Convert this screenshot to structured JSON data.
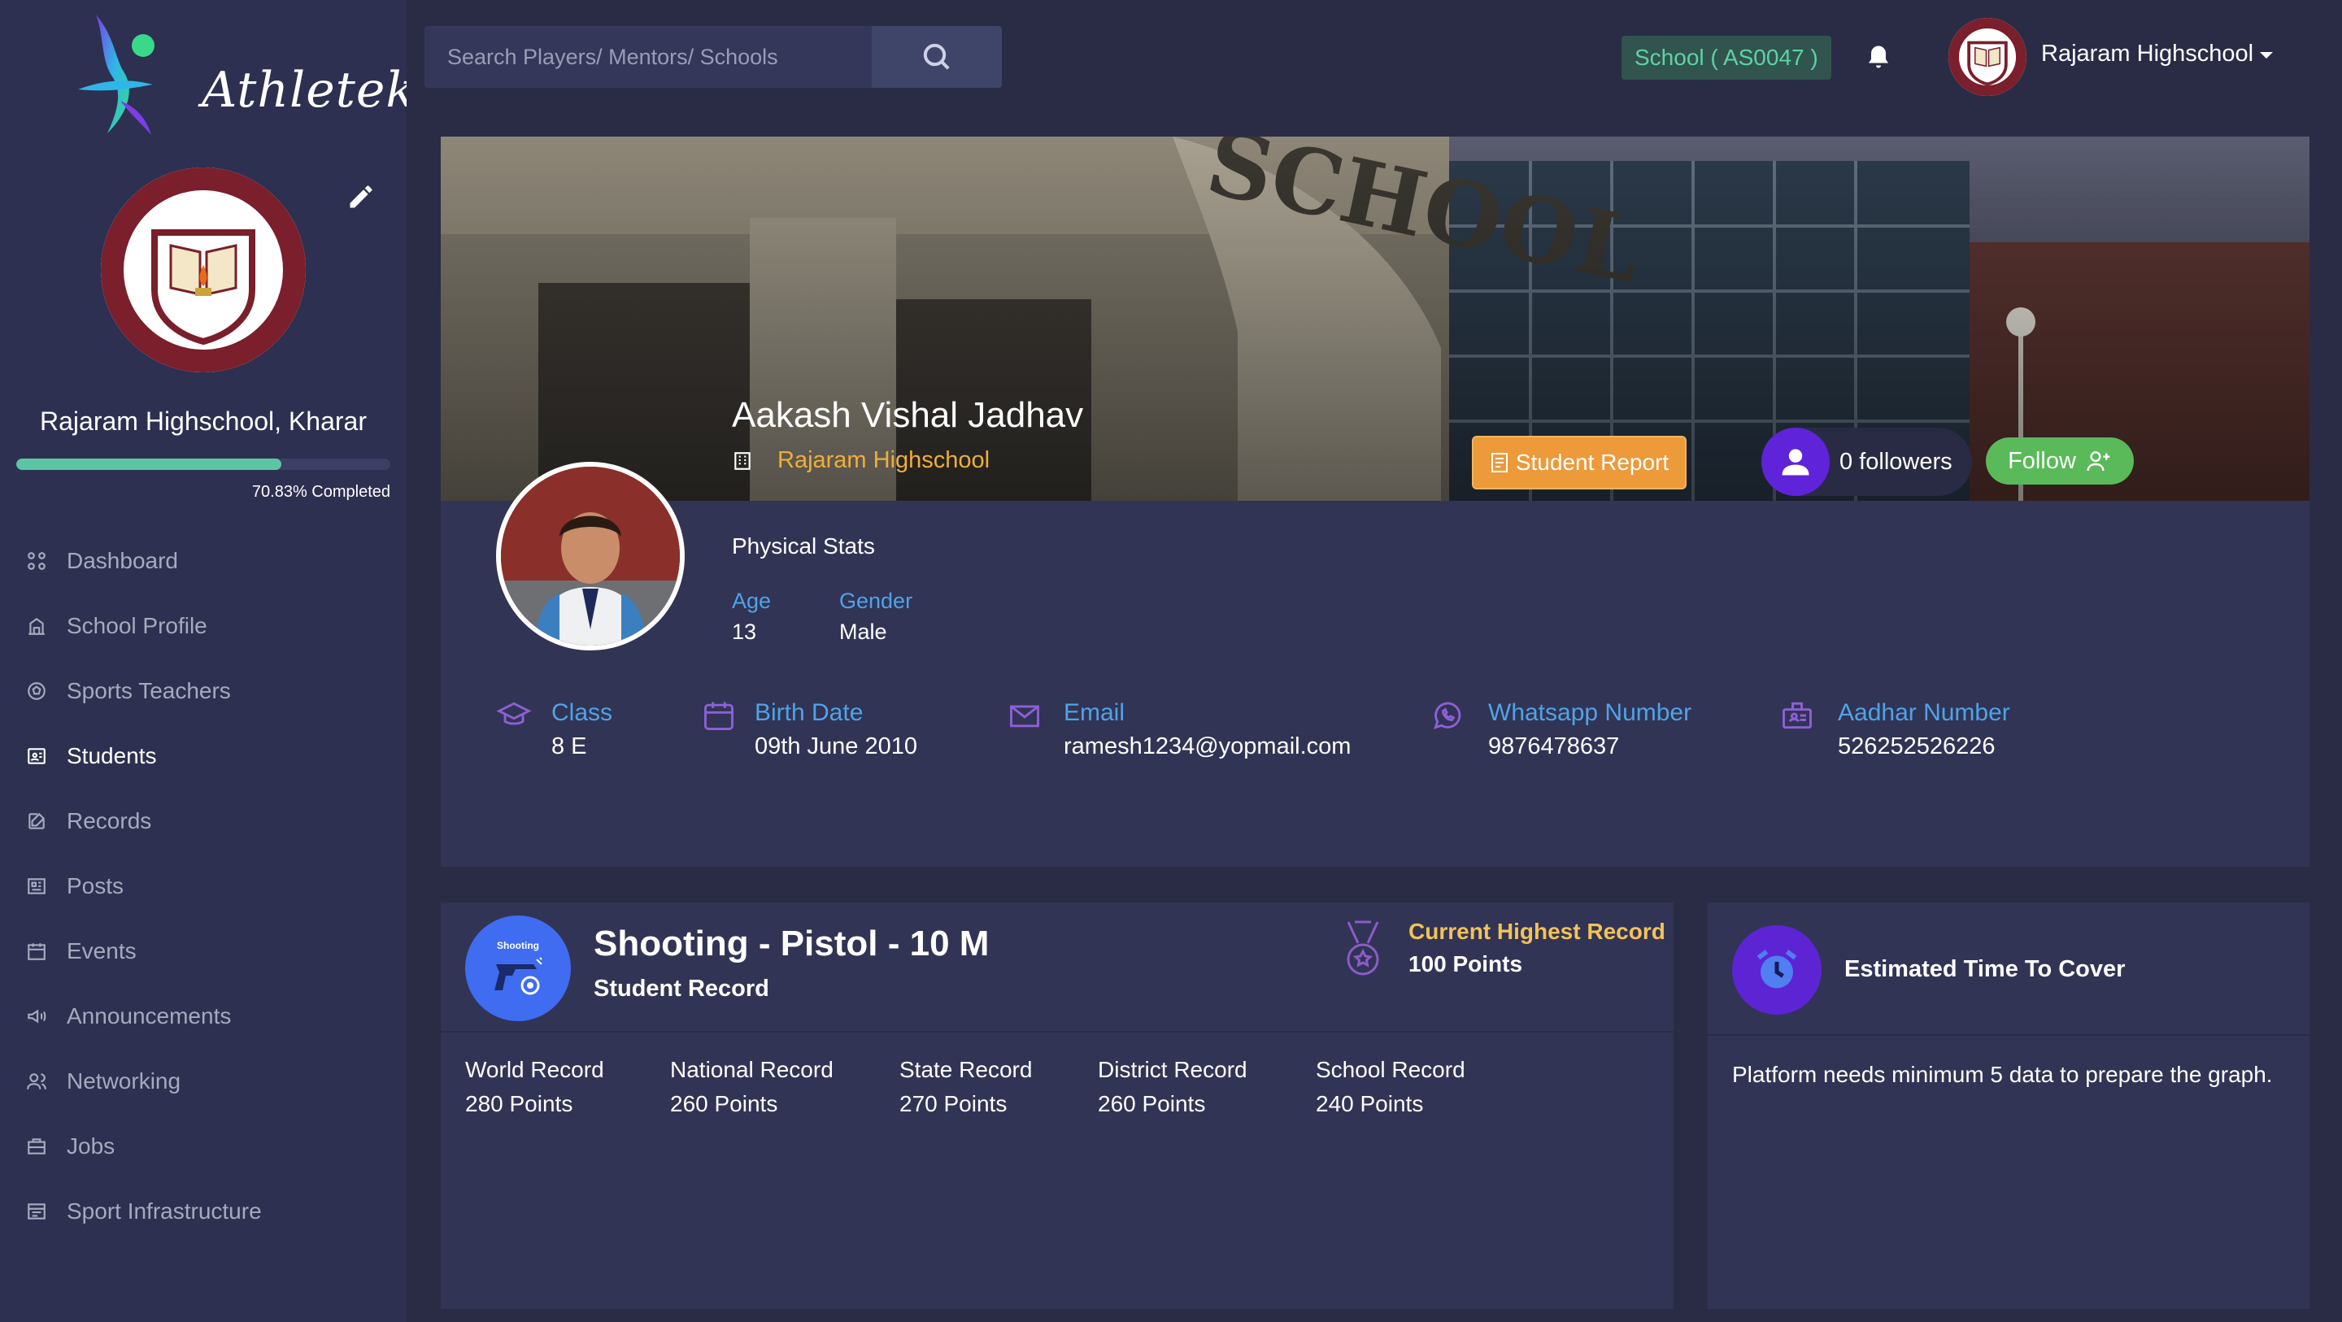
{
  "brand": {
    "name": "Athletekar"
  },
  "sidebar": {
    "school_name": "Rajaram Highschool, Kharar",
    "progress": {
      "percent": 70.83,
      "label": "70.83% Completed"
    },
    "items": [
      {
        "label": "Dashboard",
        "icon": "grid-icon",
        "active": false
      },
      {
        "label": "School Profile",
        "icon": "building-icon",
        "active": false
      },
      {
        "label": "Sports Teachers",
        "icon": "soccer-ball-icon",
        "active": false
      },
      {
        "label": "Students",
        "icon": "id-card-icon",
        "active": true
      },
      {
        "label": "Records",
        "icon": "edit-record-icon",
        "active": false
      },
      {
        "label": "Posts",
        "icon": "newspaper-icon",
        "active": false
      },
      {
        "label": "Events",
        "icon": "calendar-icon",
        "active": false
      },
      {
        "label": "Announcements",
        "icon": "megaphone-icon",
        "active": false
      },
      {
        "label": "Networking",
        "icon": "users-icon",
        "active": false
      },
      {
        "label": "Jobs",
        "icon": "briefcase-icon",
        "active": false
      },
      {
        "label": "Sport Infrastructure",
        "icon": "infrastructure-icon",
        "active": false
      }
    ]
  },
  "header": {
    "search_placeholder": "Search Players/ Mentors/ Schools",
    "school_id": "School ( AS0047 )",
    "user_name": "Rajaram Highschool"
  },
  "profile": {
    "name": "Aakash Vishal Jadhav",
    "school": "Rajaram Highschool",
    "report_label": "Student Report",
    "followers_label": "0 followers",
    "follow_label": "Follow",
    "stats_title": "Physical Stats",
    "age_label": "Age",
    "age_value": "13",
    "gender_label": "Gender",
    "gender_value": "Male",
    "info": [
      {
        "label": "Class",
        "value": "8 E"
      },
      {
        "label": "Birth Date",
        "value": "09th June 2010"
      },
      {
        "label": "Email",
        "value": "ramesh1234@yopmail.com"
      },
      {
        "label": "Whatsapp Number",
        "value": "9876478637"
      },
      {
        "label": "Aadhar Number",
        "value": "526252526226"
      }
    ]
  },
  "record": {
    "badge_label": "Shooting",
    "title": "Shooting - Pistol - 10 M",
    "subtitle": "Student Record",
    "current_label": "Current Highest Record",
    "current_value": "100 Points",
    "records": [
      {
        "label": "World Record",
        "value": "280 Points"
      },
      {
        "label": "National Record",
        "value": "260 Points"
      },
      {
        "label": "State Record",
        "value": "270 Points"
      },
      {
        "label": "District Record",
        "value": "260 Points"
      },
      {
        "label": "School Record",
        "value": "240 Points"
      }
    ]
  },
  "estimate": {
    "title": "Estimated Time To Cover",
    "message": "Platform needs minimum 5 data to prepare the graph."
  },
  "colors": {
    "background": "#2a2c46",
    "sidebar": "#2d3050",
    "card": "#313454",
    "accent_blue": "#4fa3e8",
    "accent_green": "#5cc6a4",
    "school_orange": "#f0ae3a",
    "report_orange": "#ec9a3a",
    "follow_green": "#5aba5a",
    "purple": "#5f23d9",
    "gold": "#f2c25a"
  }
}
